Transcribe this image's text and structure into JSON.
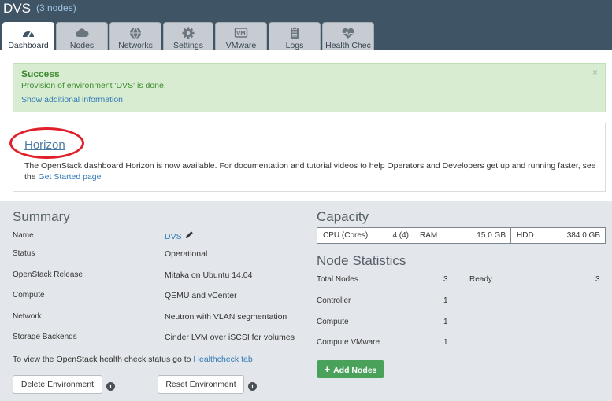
{
  "header": {
    "title": "DVS",
    "nodes": "(3 nodes)"
  },
  "tabs": [
    {
      "label": "Dashboard",
      "icon": "dashboard-gauge-icon",
      "active": true
    },
    {
      "label": "Nodes",
      "icon": "cloud-icon"
    },
    {
      "label": "Networks",
      "icon": "globe-icon"
    },
    {
      "label": "Settings",
      "icon": "gear-icon"
    },
    {
      "label": "VMware",
      "icon": "vmware-icon"
    },
    {
      "label": "Logs",
      "icon": "clipboard-icon"
    },
    {
      "label": "Health Chec",
      "icon": "heart-pulse-icon"
    }
  ],
  "alert": {
    "title": "Success",
    "message": "Provision of environment 'DVS' is done.",
    "link": "Show additional information",
    "close": "×"
  },
  "horizon": {
    "title": "Horizon",
    "text": "The OpenStack dashboard Horizon is now available. For documentation and tutorial videos to help Operators and Developers get up and running faster, see the ",
    "link": "Get Started page"
  },
  "summary": {
    "title": "Summary",
    "rows": [
      {
        "label": "Name",
        "value": "DVS"
      },
      {
        "label": "Status",
        "value": "Operational"
      },
      {
        "label": "OpenStack Release",
        "value": "Mitaka on Ubuntu 14.04"
      },
      {
        "label": "Compute",
        "value": "QEMU and vCenter"
      },
      {
        "label": "Network",
        "value": "Neutron with VLAN segmentation"
      },
      {
        "label": "Storage Backends",
        "value": "Cinder LVM over iSCSI for volumes"
      }
    ],
    "healthcheck_text": "To view the OpenStack health check status go to ",
    "healthcheck_link": "Healthcheck tab",
    "delete_button": "Delete Environment",
    "reset_button": "Reset Environment",
    "info_glyph": "i"
  },
  "capacity": {
    "title": "Capacity",
    "cells": [
      {
        "label": "CPU (Cores)",
        "value": "4 (4)"
      },
      {
        "label": "RAM",
        "value": "15.0 GB"
      },
      {
        "label": "HDD",
        "value": "384.0 GB"
      }
    ]
  },
  "node_statistics": {
    "title": "Node Statistics",
    "rows": [
      {
        "label": "Total Nodes",
        "value": "3"
      },
      {
        "label": "Controller",
        "value": "1"
      },
      {
        "label": "Compute",
        "value": "1"
      },
      {
        "label": "Compute VMware",
        "value": "1"
      }
    ],
    "ready_label": "Ready",
    "ready_value": "3",
    "add_button": "Add Nodes",
    "add_glyph": "+"
  },
  "colors": {
    "header_bg": "#3f5465",
    "success_bg": "#d7ecd1",
    "success_text": "#3c8a2e",
    "link": "#317ab5",
    "add_button": "#4aa15a",
    "annotation_ring": "#e0202a"
  }
}
